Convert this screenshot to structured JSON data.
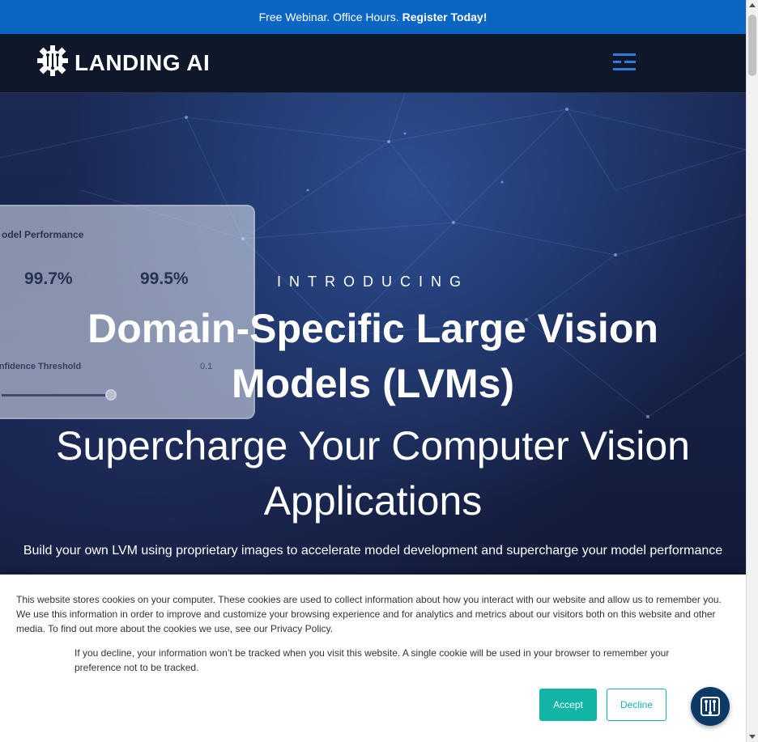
{
  "banner": {
    "text": "Free Webinar. Office Hours.",
    "link": "Register Today!"
  },
  "header": {
    "logo_text": "LANDING AI",
    "logo_icon": "gear-chip-icon",
    "menu_icon": "hamburger-menu-icon"
  },
  "hero": {
    "eyebrow": "INTRODUCING",
    "title": "Domain-Specific Large Vision Models (LVMs)",
    "subtitle": "Supercharge Your Computer Vision Applications",
    "description": "Build your own LVM using proprietary images to accelerate model development and supercharge your model performance",
    "panel": {
      "title": "odel Performance",
      "value_1": "99.7%",
      "value_2": "99.5%",
      "label": "onfidence Threshold",
      "small": "0.1"
    }
  },
  "cookie_notice": {
    "paragraph_1": "This website stores cookies on your computer. These cookies are used to collect information about how you interact with our website and allow us to remember you. We use this information in order to improve and customize your browsing experience and for analytics and metrics about our visitors both on this website and other media. To find out more about the cookies we use, see our Privacy Policy.",
    "paragraph_2": "If you decline, your information won’t be tracked when you visit this website. A single cookie will be used in your browser to remember your preference not to be tracked.",
    "accept_label": "Accept",
    "decline_label": "Decline"
  },
  "chat": {
    "icon": "chat-bot-icon"
  },
  "colors": {
    "banner_bg": "#0a66c2",
    "nav_bg": "#0f172a",
    "accent_teal": "#12b5a5",
    "menu_blue": "#2f7bd8"
  }
}
